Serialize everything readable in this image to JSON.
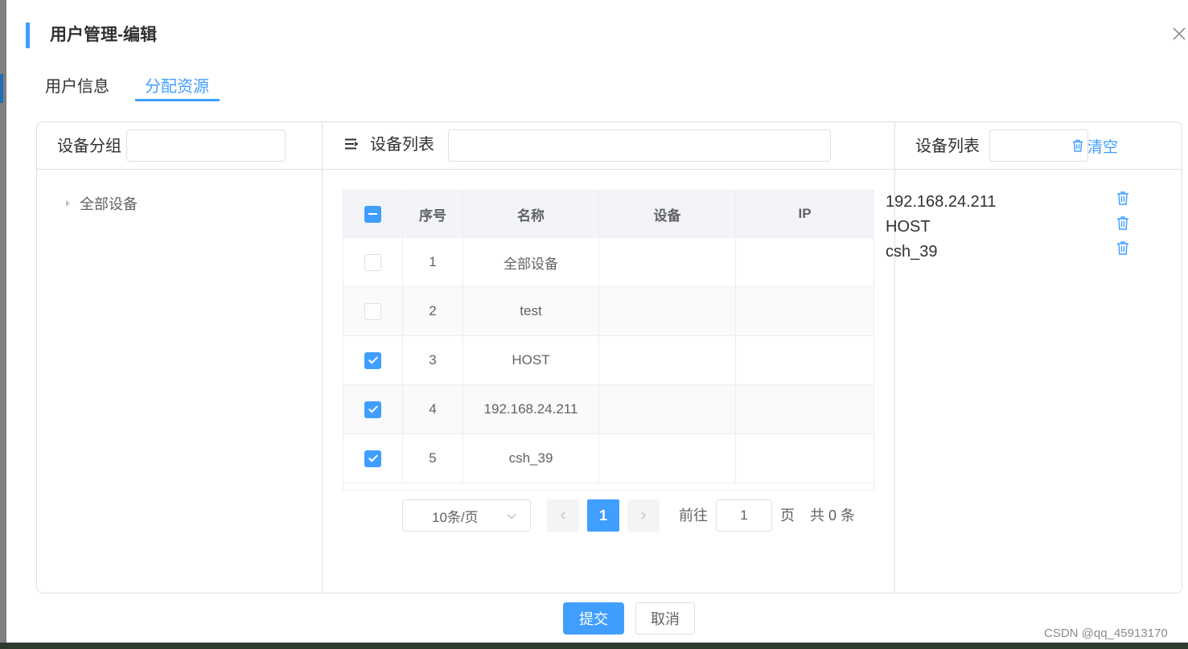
{
  "dialog": {
    "title": "用户管理-编辑",
    "close_icon": "close-icon"
  },
  "tabs": [
    {
      "label": "用户信息",
      "active": false
    },
    {
      "label": "分配资源",
      "active": true
    }
  ],
  "group_panel": {
    "label": "设备分组",
    "search_value": "",
    "tree": [
      {
        "label": "全部设备",
        "expanded": false
      }
    ]
  },
  "device_panel": {
    "menu_icon": "list-menu-icon",
    "label": "设备列表",
    "search_value": "",
    "table": {
      "headers": [
        "序号",
        "名称",
        "设备",
        "IP"
      ],
      "header_check": "indeterminate",
      "rows": [
        {
          "index": "1",
          "name": "全部设备",
          "device": "",
          "ip": "",
          "checked": false
        },
        {
          "index": "2",
          "name": "test",
          "device": "",
          "ip": "",
          "checked": false
        },
        {
          "index": "3",
          "name": "HOST",
          "device": "",
          "ip": "",
          "checked": true
        },
        {
          "index": "4",
          "name": "192.168.24.211",
          "device": "",
          "ip": "",
          "checked": true
        },
        {
          "index": "5",
          "name": "csh_39",
          "device": "",
          "ip": "",
          "checked": true
        }
      ]
    },
    "pagination": {
      "page_size": "10条/页",
      "current_page": "1",
      "goto_label": "前往",
      "goto_value": "1",
      "page_unit": "页",
      "total": "共 0 条"
    }
  },
  "selected_panel": {
    "label": "设备列表",
    "search_value": "",
    "clear_label": "清空",
    "items": [
      "192.168.24.211",
      "HOST",
      "csh_39"
    ]
  },
  "footer": {
    "submit_label": "提交",
    "cancel_label": "取消"
  },
  "watermark": "CSDN @qq_45913170",
  "colors": {
    "accent": "#409eff",
    "border": "#dcdfe6",
    "text": "#303133"
  }
}
